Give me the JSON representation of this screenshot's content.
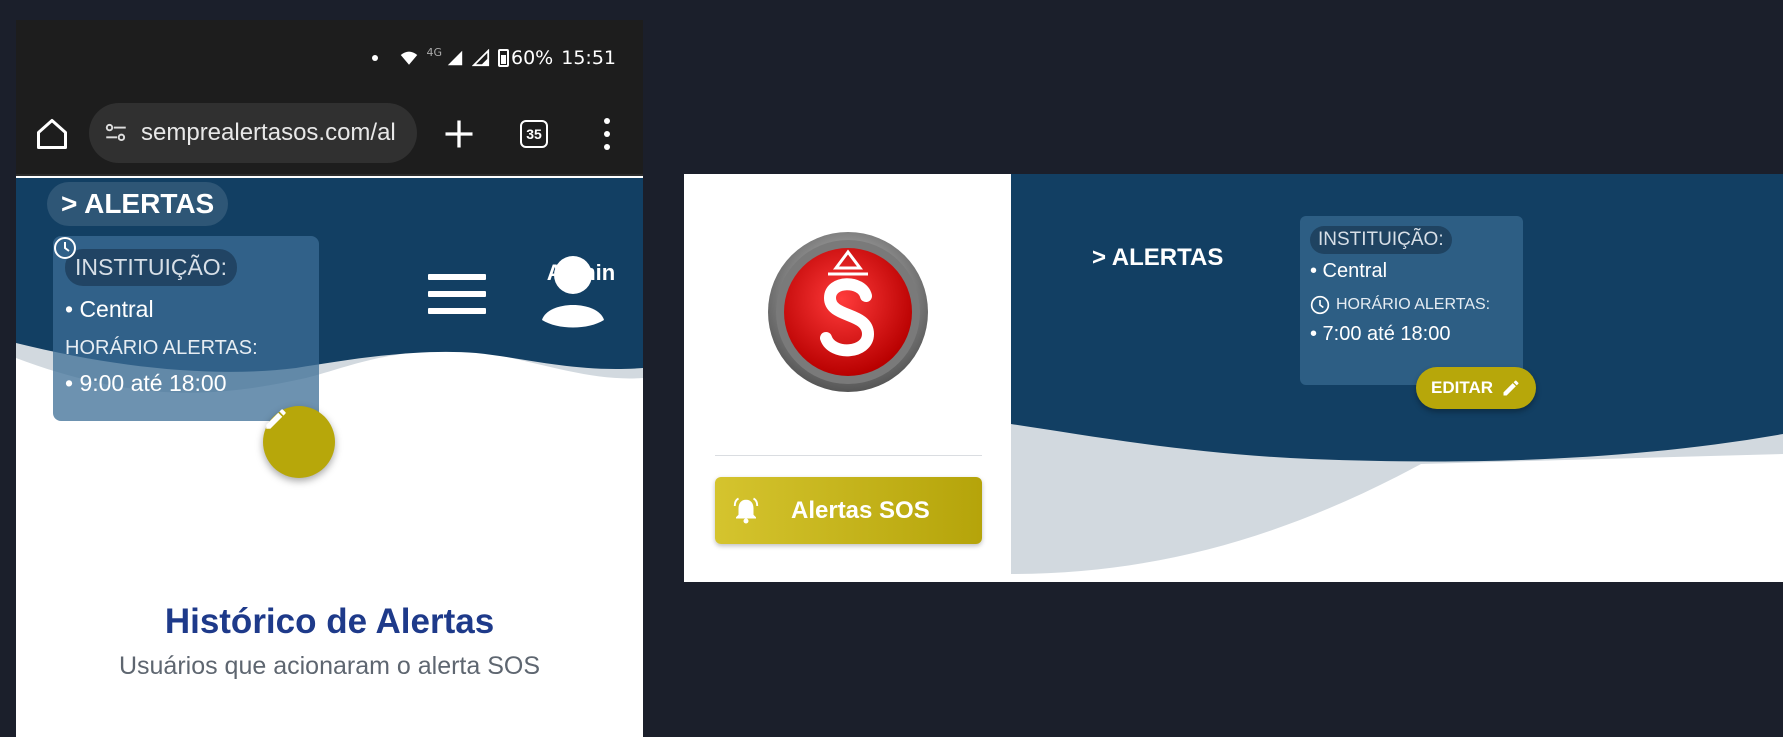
{
  "phone": {
    "status": {
      "network": "4G",
      "battery": "60%",
      "time": "15:51"
    },
    "browser": {
      "url": "semprealertasos.com/al",
      "tab_count": "35"
    },
    "breadcrumb": "> ALERTAS",
    "institution": {
      "label": "INSTITUIÇÃO:",
      "value": "• Central",
      "hours_label": "HORÁRIO ALERTAS:",
      "hours_value": "• 9:00 até 18:00"
    },
    "user": {
      "name": "Admin"
    },
    "history": {
      "title": "Histórico de Alertas",
      "subtitle": "Usuários que acionaram o alerta SOS"
    }
  },
  "desktop": {
    "sidebar": {
      "sos_button": "Alertas SOS"
    },
    "breadcrumb": "> ALERTAS",
    "institution": {
      "label": "INSTITUIÇÃO:",
      "value": "• Central",
      "hours_label": "HORÁRIO ALERTAS:",
      "hours_value": "• 7:00 até 18:00"
    },
    "edit_button": "EDITAR"
  },
  "colors": {
    "header_navy": "#123f63",
    "accent_gold": "#b7a70a",
    "title_blue": "#1e3a8a",
    "wave_gray": "#d2d9df",
    "logo_red": "#e11414"
  }
}
